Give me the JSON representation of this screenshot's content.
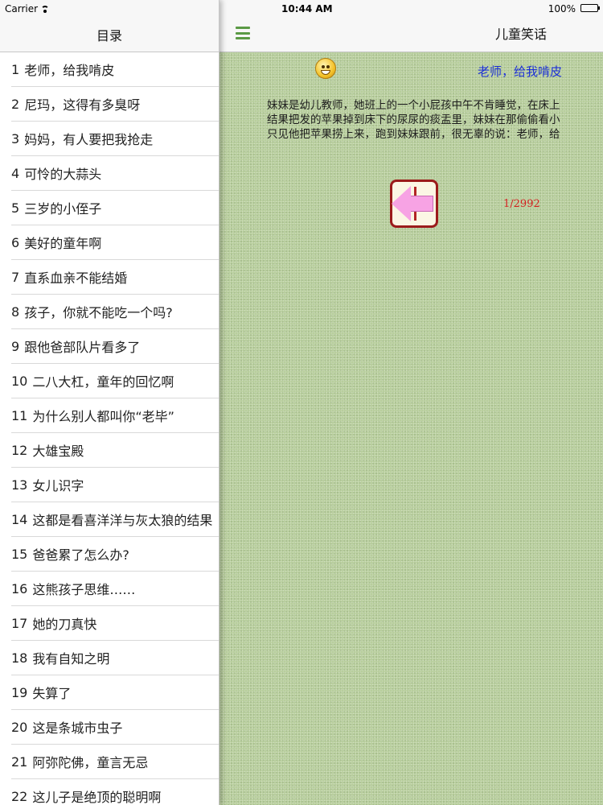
{
  "sidebar": {
    "status_bar": {
      "carrier": "Carrier"
    },
    "title": "目录",
    "items": [
      {
        "num": "1",
        "title": "老师，给我啃皮"
      },
      {
        "num": "2",
        "title": "尼玛，这得有多臭呀"
      },
      {
        "num": "3",
        "title": "妈妈，有人要把我抢走"
      },
      {
        "num": "4",
        "title": "可怜的大蒜头"
      },
      {
        "num": "5",
        "title": "三岁的小侄子"
      },
      {
        "num": "6",
        "title": "美好的童年啊"
      },
      {
        "num": "7",
        "title": "直系血亲不能结婚"
      },
      {
        "num": "8",
        "title": "孩子，你就不能吃一个吗?"
      },
      {
        "num": "9",
        "title": "跟他爸部队片看多了"
      },
      {
        "num": "10",
        "title": "二八大杠，童年的回忆啊"
      },
      {
        "num": "11",
        "title": "为什么别人都叫你“老毕”"
      },
      {
        "num": "12",
        "title": "大雄宝殿"
      },
      {
        "num": "13",
        "title": "女儿识字"
      },
      {
        "num": "14",
        "title": "这都是看喜洋洋与灰太狼的结果"
      },
      {
        "num": "15",
        "title": "爸爸累了怎么办?"
      },
      {
        "num": "16",
        "title": "这熊孩子思维……"
      },
      {
        "num": "17",
        "title": "她的刀真快"
      },
      {
        "num": "18",
        "title": "我有自知之明"
      },
      {
        "num": "19",
        "title": "失算了"
      },
      {
        "num": "20",
        "title": "这是条城市虫子"
      },
      {
        "num": "21",
        "title": "阿弥陀佛，童言无忌"
      },
      {
        "num": "22",
        "title": "这儿子是绝顶的聪明啊"
      }
    ]
  },
  "main": {
    "status_bar": {
      "time": "10:44 AM",
      "battery": "100%"
    },
    "title": "儿童笑话",
    "menu_icon": "hamburger-menu-icon",
    "joke": {
      "title": "老师，给我啃皮",
      "lines": [
        "妹妹是幼儿教师，她班上的一个小屁孩中午不肯睡觉，在床上",
        "结果把发的苹果掉到床下的尿尿的痰盂里，妹妹在那偷偷看小",
        "只见他把苹果捞上来，跑到妹妹跟前，很无辜的说：老师，给"
      ]
    },
    "pager": {
      "counter": "1/2992",
      "back_icon": "back-arrow-icon"
    }
  },
  "colors": {
    "accent_green": "#5b9a45",
    "title_blue": "#1b2fd6",
    "counter_red": "#d42020",
    "paper_green": "#b7cd9b"
  }
}
